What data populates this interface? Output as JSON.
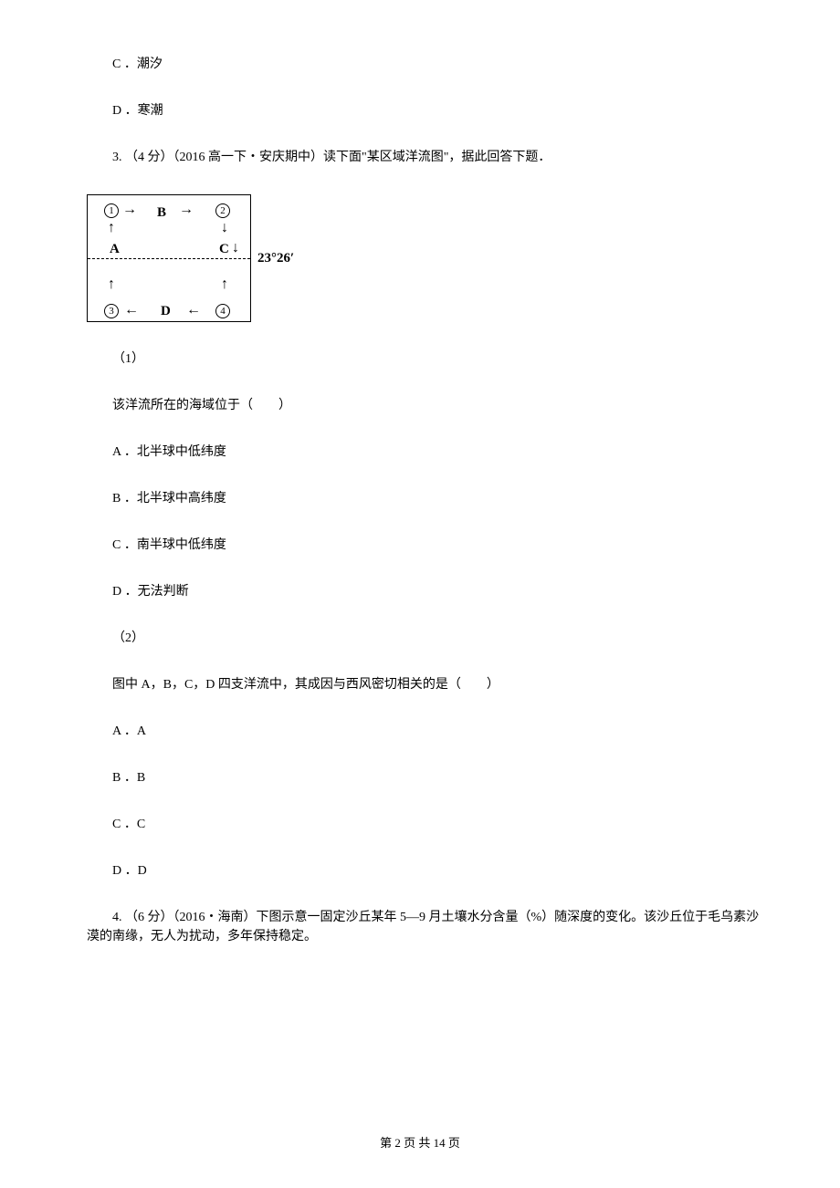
{
  "opt_c": "C ．潮汐",
  "opt_d": "D ．寒潮",
  "q3": {
    "stem": "3.  （4 分）（2016 高一下・安庆期中）读下面\"某区域洋流图\"，据此回答下题．",
    "lat": "23°26′",
    "circ1": "1",
    "circ2": "2",
    "circ3": "3",
    "circ4": "4",
    "A": "A",
    "B": "B",
    "C": "C",
    "D": "D",
    "sub1": "（1）",
    "sub1_q": "该洋流所在的海域位于（　　）",
    "sub1_a": "A ．北半球中低纬度",
    "sub1_b": "B ．北半球中高纬度",
    "sub1_c": "C ．南半球中低纬度",
    "sub1_d": "D ．无法判断",
    "sub2": "（2）",
    "sub2_q": "图中 A，B，C，D 四支洋流中，其成因与西风密切相关的是（　　）",
    "sub2_a": "A ．A",
    "sub2_b": "B ．B",
    "sub2_c": "C ．C",
    "sub2_d": "D ．D"
  },
  "q4": {
    "stem": "4.  （6 分）（2016・海南）下图示意一固定沙丘某年 5—9 月土壤水分含量（%）随深度的变化。该沙丘位于毛乌素沙漠的南缘，无人为扰动，多年保持稳定。"
  },
  "footer": "第 2 页 共 14 页"
}
